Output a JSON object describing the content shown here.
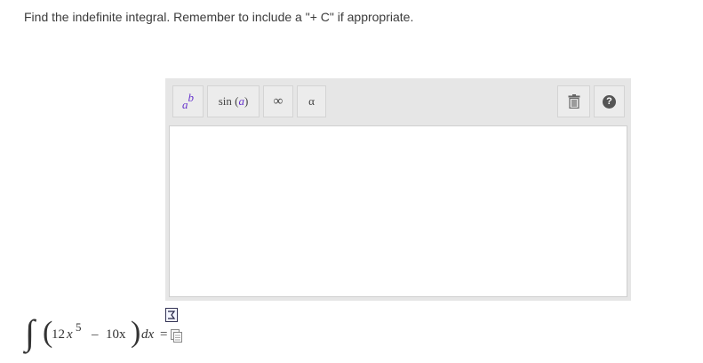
{
  "question": {
    "prompt": "Find the indefinite integral. Remember to include a \"+ C\" if appropriate."
  },
  "toolbar": {
    "power": {
      "base": "a",
      "exponent": "b",
      "icon": "power-icon"
    },
    "trig": {
      "func": "sin",
      "open": "(",
      "var": "a",
      "close": ")"
    },
    "infinity": {
      "symbol": "∞"
    },
    "greek": {
      "symbol": "α"
    },
    "trash": {
      "icon": "trash-icon"
    },
    "help": {
      "symbol": "?"
    }
  },
  "answer": {
    "value": ""
  },
  "expression": {
    "integral": "∫",
    "paren_open": "(",
    "coefficient": "12",
    "variable": "x",
    "exponent": "5",
    "operator": "–",
    "term2": "10x",
    "paren_close": ")",
    "differential": "dx",
    "equals": "="
  },
  "colors": {
    "accent_purple": "#6633cc",
    "toolbar_bg": "#e6e6e6",
    "button_bg": "#ececec"
  }
}
